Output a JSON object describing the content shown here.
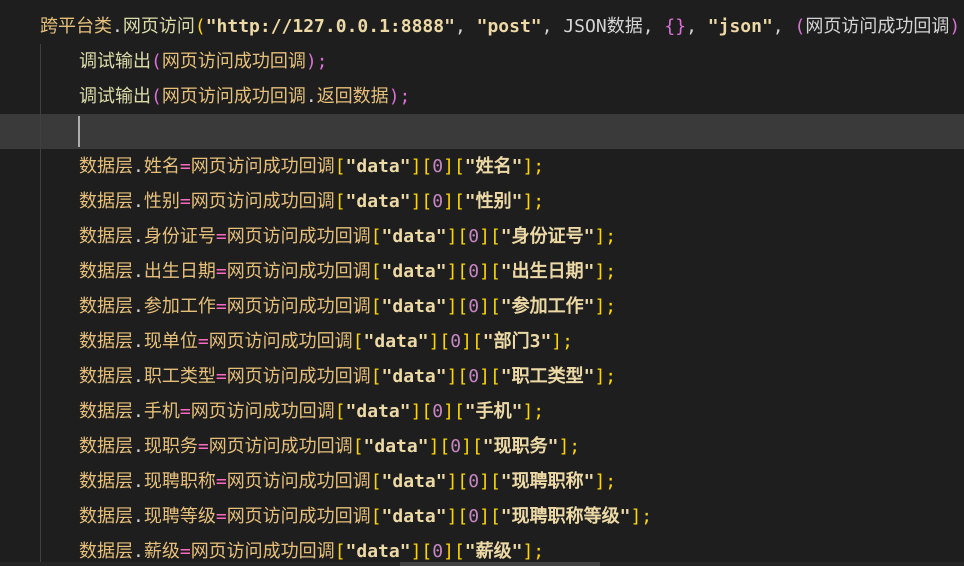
{
  "editor": {
    "lines": [
      {
        "segments": [
          {
            "t": "跨平台类",
            "c": "id"
          },
          {
            "t": ".",
            "c": "plain"
          },
          {
            "t": "网页访问",
            "c": "fn"
          },
          {
            "t": "(",
            "c": "ybr"
          },
          {
            "t": "\"http://127.0.0.1:8888\"",
            "c": "str"
          },
          {
            "t": ", ",
            "c": "plain"
          },
          {
            "t": "\"post\"",
            "c": "str"
          },
          {
            "t": ", ",
            "c": "plain"
          },
          {
            "t": "JSON数据",
            "c": "plain"
          },
          {
            "t": ", ",
            "c": "plain"
          },
          {
            "t": "{}",
            "c": "pur"
          },
          {
            "t": ", ",
            "c": "plain"
          },
          {
            "t": "\"json\"",
            "c": "str"
          },
          {
            "t": ", ",
            "c": "plain"
          },
          {
            "t": "(",
            "c": "pur"
          },
          {
            "t": "网页访问成功回调",
            "c": "plain"
          },
          {
            "t": ")",
            "c": "pur"
          },
          {
            "t": " ⇒ ",
            "c": "arr"
          },
          {
            "t": "{",
            "c": "pur"
          }
        ]
      },
      {
        "segments": [
          {
            "t": "调试输出",
            "c": "fn"
          },
          {
            "t": "(",
            "c": "pur"
          },
          {
            "t": "网页访问成功回调",
            "c": "id"
          },
          {
            "t": ");",
            "c": "pur"
          }
        ]
      },
      {
        "segments": [
          {
            "t": "调试输出",
            "c": "fn"
          },
          {
            "t": "(",
            "c": "pur"
          },
          {
            "t": "网页访问成功回调",
            "c": "id"
          },
          {
            "t": ".",
            "c": "plain"
          },
          {
            "t": "返回数据",
            "c": "id"
          },
          {
            "t": ");",
            "c": "pur"
          }
        ]
      },
      {
        "segments": []
      },
      {
        "segments": [
          {
            "t": "数据层",
            "c": "id"
          },
          {
            "t": ".",
            "c": "plain"
          },
          {
            "t": "姓名",
            "c": "id"
          },
          {
            "t": "=",
            "c": "op"
          },
          {
            "t": "网页访问成功回调",
            "c": "id"
          },
          {
            "t": "[",
            "c": "ybr"
          },
          {
            "t": "\"data\"",
            "c": "str"
          },
          {
            "t": "]",
            "c": "ybr"
          },
          {
            "t": "[",
            "c": "ybr"
          },
          {
            "t": "0",
            "c": "idx"
          },
          {
            "t": "]",
            "c": "ybr"
          },
          {
            "t": "[",
            "c": "ybr"
          },
          {
            "t": "\"姓名\"",
            "c": "str"
          },
          {
            "t": "];",
            "c": "ybr"
          }
        ]
      },
      {
        "segments": [
          {
            "t": "数据层",
            "c": "id"
          },
          {
            "t": ".",
            "c": "plain"
          },
          {
            "t": "性别",
            "c": "id"
          },
          {
            "t": "=",
            "c": "op"
          },
          {
            "t": "网页访问成功回调",
            "c": "id"
          },
          {
            "t": "[",
            "c": "ybr"
          },
          {
            "t": "\"data\"",
            "c": "str"
          },
          {
            "t": "]",
            "c": "ybr"
          },
          {
            "t": "[",
            "c": "ybr"
          },
          {
            "t": "0",
            "c": "idx"
          },
          {
            "t": "]",
            "c": "ybr"
          },
          {
            "t": "[",
            "c": "ybr"
          },
          {
            "t": "\"性别\"",
            "c": "str"
          },
          {
            "t": "];",
            "c": "ybr"
          }
        ]
      },
      {
        "segments": [
          {
            "t": "数据层",
            "c": "id"
          },
          {
            "t": ".",
            "c": "plain"
          },
          {
            "t": "身份证号",
            "c": "id"
          },
          {
            "t": "=",
            "c": "op"
          },
          {
            "t": "网页访问成功回调",
            "c": "id"
          },
          {
            "t": "[",
            "c": "ybr"
          },
          {
            "t": "\"data\"",
            "c": "str"
          },
          {
            "t": "]",
            "c": "ybr"
          },
          {
            "t": "[",
            "c": "ybr"
          },
          {
            "t": "0",
            "c": "idx"
          },
          {
            "t": "]",
            "c": "ybr"
          },
          {
            "t": "[",
            "c": "ybr"
          },
          {
            "t": "\"身份证号\"",
            "c": "str"
          },
          {
            "t": "];",
            "c": "ybr"
          }
        ]
      },
      {
        "segments": [
          {
            "t": "数据层",
            "c": "id"
          },
          {
            "t": ".",
            "c": "plain"
          },
          {
            "t": "出生日期",
            "c": "id"
          },
          {
            "t": "=",
            "c": "op"
          },
          {
            "t": "网页访问成功回调",
            "c": "id"
          },
          {
            "t": "[",
            "c": "ybr"
          },
          {
            "t": "\"data\"",
            "c": "str"
          },
          {
            "t": "]",
            "c": "ybr"
          },
          {
            "t": "[",
            "c": "ybr"
          },
          {
            "t": "0",
            "c": "idx"
          },
          {
            "t": "]",
            "c": "ybr"
          },
          {
            "t": "[",
            "c": "ybr"
          },
          {
            "t": "\"出生日期\"",
            "c": "str"
          },
          {
            "t": "];",
            "c": "ybr"
          }
        ]
      },
      {
        "segments": [
          {
            "t": "数据层",
            "c": "id"
          },
          {
            "t": ".",
            "c": "plain"
          },
          {
            "t": "参加工作",
            "c": "id"
          },
          {
            "t": "=",
            "c": "op"
          },
          {
            "t": "网页访问成功回调",
            "c": "id"
          },
          {
            "t": "[",
            "c": "ybr"
          },
          {
            "t": "\"data\"",
            "c": "str"
          },
          {
            "t": "]",
            "c": "ybr"
          },
          {
            "t": "[",
            "c": "ybr"
          },
          {
            "t": "0",
            "c": "idx"
          },
          {
            "t": "]",
            "c": "ybr"
          },
          {
            "t": "[",
            "c": "ybr"
          },
          {
            "t": "\"参加工作\"",
            "c": "str"
          },
          {
            "t": "];",
            "c": "ybr"
          }
        ]
      },
      {
        "segments": [
          {
            "t": "数据层",
            "c": "id"
          },
          {
            "t": ".",
            "c": "plain"
          },
          {
            "t": "现单位",
            "c": "id"
          },
          {
            "t": "=",
            "c": "op"
          },
          {
            "t": "网页访问成功回调",
            "c": "id"
          },
          {
            "t": "[",
            "c": "ybr"
          },
          {
            "t": "\"data\"",
            "c": "str"
          },
          {
            "t": "]",
            "c": "ybr"
          },
          {
            "t": "[",
            "c": "ybr"
          },
          {
            "t": "0",
            "c": "idx"
          },
          {
            "t": "]",
            "c": "ybr"
          },
          {
            "t": "[",
            "c": "ybr"
          },
          {
            "t": "\"部门3\"",
            "c": "str"
          },
          {
            "t": "];",
            "c": "ybr"
          }
        ]
      },
      {
        "segments": [
          {
            "t": "数据层",
            "c": "id"
          },
          {
            "t": ".",
            "c": "plain"
          },
          {
            "t": "职工类型",
            "c": "id"
          },
          {
            "t": "=",
            "c": "op"
          },
          {
            "t": "网页访问成功回调",
            "c": "id"
          },
          {
            "t": "[",
            "c": "ybr"
          },
          {
            "t": "\"data\"",
            "c": "str"
          },
          {
            "t": "]",
            "c": "ybr"
          },
          {
            "t": "[",
            "c": "ybr"
          },
          {
            "t": "0",
            "c": "idx"
          },
          {
            "t": "]",
            "c": "ybr"
          },
          {
            "t": "[",
            "c": "ybr"
          },
          {
            "t": "\"职工类型\"",
            "c": "str"
          },
          {
            "t": "];",
            "c": "ybr"
          }
        ]
      },
      {
        "segments": [
          {
            "t": "数据层",
            "c": "id"
          },
          {
            "t": ".",
            "c": "plain"
          },
          {
            "t": "手机",
            "c": "id"
          },
          {
            "t": "=",
            "c": "op"
          },
          {
            "t": "网页访问成功回调",
            "c": "id"
          },
          {
            "t": "[",
            "c": "ybr"
          },
          {
            "t": "\"data\"",
            "c": "str"
          },
          {
            "t": "]",
            "c": "ybr"
          },
          {
            "t": "[",
            "c": "ybr"
          },
          {
            "t": "0",
            "c": "idx"
          },
          {
            "t": "]",
            "c": "ybr"
          },
          {
            "t": "[",
            "c": "ybr"
          },
          {
            "t": "\"手机\"",
            "c": "str"
          },
          {
            "t": "];",
            "c": "ybr"
          }
        ]
      },
      {
        "segments": [
          {
            "t": "数据层",
            "c": "id"
          },
          {
            "t": ".",
            "c": "plain"
          },
          {
            "t": "现职务",
            "c": "id"
          },
          {
            "t": "=",
            "c": "op"
          },
          {
            "t": "网页访问成功回调",
            "c": "id"
          },
          {
            "t": "[",
            "c": "ybr"
          },
          {
            "t": "\"data\"",
            "c": "str"
          },
          {
            "t": "]",
            "c": "ybr"
          },
          {
            "t": "[",
            "c": "ybr"
          },
          {
            "t": "0",
            "c": "idx"
          },
          {
            "t": "]",
            "c": "ybr"
          },
          {
            "t": "[",
            "c": "ybr"
          },
          {
            "t": "\"现职务\"",
            "c": "str"
          },
          {
            "t": "];",
            "c": "ybr"
          }
        ]
      },
      {
        "segments": [
          {
            "t": "数据层",
            "c": "id"
          },
          {
            "t": ".",
            "c": "plain"
          },
          {
            "t": "现聘职称",
            "c": "id"
          },
          {
            "t": "=",
            "c": "op"
          },
          {
            "t": "网页访问成功回调",
            "c": "id"
          },
          {
            "t": "[",
            "c": "ybr"
          },
          {
            "t": "\"data\"",
            "c": "str"
          },
          {
            "t": "]",
            "c": "ybr"
          },
          {
            "t": "[",
            "c": "ybr"
          },
          {
            "t": "0",
            "c": "idx"
          },
          {
            "t": "]",
            "c": "ybr"
          },
          {
            "t": "[",
            "c": "ybr"
          },
          {
            "t": "\"现聘职称\"",
            "c": "str"
          },
          {
            "t": "];",
            "c": "ybr"
          }
        ]
      },
      {
        "segments": [
          {
            "t": "数据层",
            "c": "id"
          },
          {
            "t": ".",
            "c": "plain"
          },
          {
            "t": "现聘等级",
            "c": "id"
          },
          {
            "t": "=",
            "c": "op"
          },
          {
            "t": "网页访问成功回调",
            "c": "id"
          },
          {
            "t": "[",
            "c": "ybr"
          },
          {
            "t": "\"data\"",
            "c": "str"
          },
          {
            "t": "]",
            "c": "ybr"
          },
          {
            "t": "[",
            "c": "ybr"
          },
          {
            "t": "0",
            "c": "idx"
          },
          {
            "t": "]",
            "c": "ybr"
          },
          {
            "t": "[",
            "c": "ybr"
          },
          {
            "t": "\"现聘职称等级\"",
            "c": "str"
          },
          {
            "t": "];",
            "c": "ybr"
          }
        ]
      },
      {
        "segments": [
          {
            "t": "数据层",
            "c": "id"
          },
          {
            "t": ".",
            "c": "plain"
          },
          {
            "t": "薪级",
            "c": "id"
          },
          {
            "t": "=",
            "c": "op"
          },
          {
            "t": "网页访问成功回调",
            "c": "id"
          },
          {
            "t": "[",
            "c": "ybr"
          },
          {
            "t": "\"data\"",
            "c": "str"
          },
          {
            "t": "]",
            "c": "ybr"
          },
          {
            "t": "[",
            "c": "ybr"
          },
          {
            "t": "0",
            "c": "idx"
          },
          {
            "t": "]",
            "c": "ybr"
          },
          {
            "t": "[",
            "c": "ybr"
          },
          {
            "t": "\"薪级\"",
            "c": "str"
          },
          {
            "t": "];",
            "c": "ybr"
          }
        ]
      }
    ],
    "current_line_index": 3,
    "colors": {
      "background": "#1e1e1e",
      "current_line": "#3a3a3a",
      "function": "#dcdcaa",
      "identifier": "#e6c07b",
      "string": "#ecd9a6",
      "bracket_purple": "#da70d6",
      "bracket_yellow": "#ffd700",
      "operator": "#ff6ac1",
      "index_number": "#c586c0",
      "arrow": "#569cd6"
    }
  }
}
